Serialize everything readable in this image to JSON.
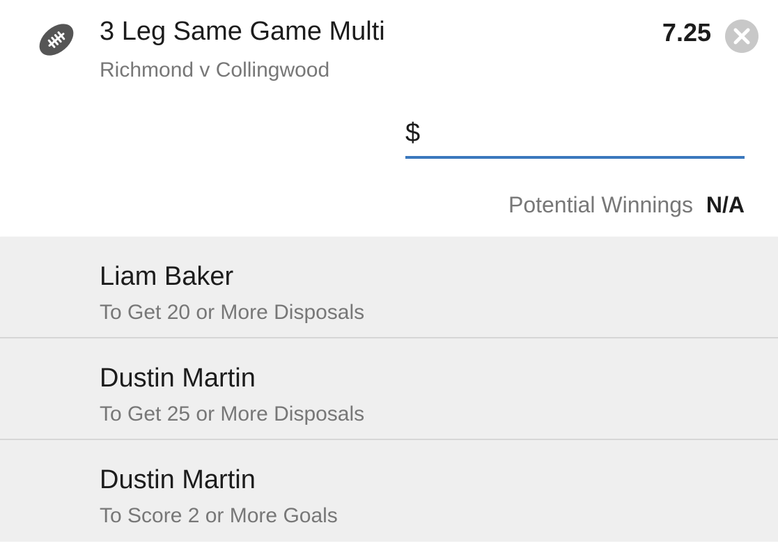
{
  "bet": {
    "sport_icon": "football-icon",
    "title": "3 Leg Same Game Multi",
    "match": "Richmond v Collingwood",
    "odds": "7.25",
    "close_icon": "close-icon"
  },
  "stake": {
    "currency": "$",
    "value": "",
    "placeholder": ""
  },
  "winnings": {
    "label": "Potential Winnings",
    "value": "N/A"
  },
  "legs": [
    {
      "name": "Liam Baker",
      "selection": "To Get 20 or More Disposals"
    },
    {
      "name": "Dustin Martin",
      "selection": "To Get 25 or More Disposals"
    },
    {
      "name": "Dustin Martin",
      "selection": "To Score 2 or More Goals"
    }
  ],
  "colors": {
    "accent": "#3b78bd",
    "icon": "#555555",
    "close_bg": "#c8c8c8",
    "legs_bg": "#efefef"
  }
}
